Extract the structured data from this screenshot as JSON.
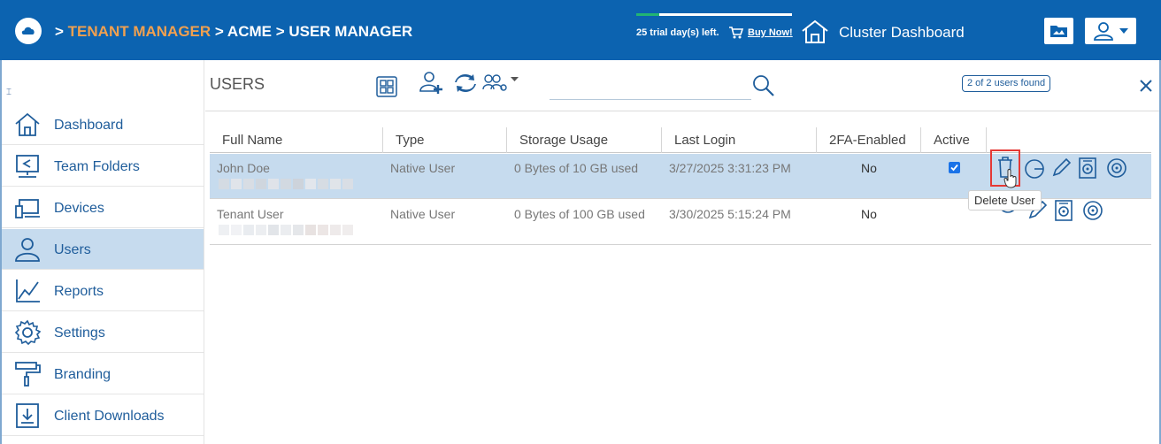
{
  "header": {
    "breadcrumb_prefix": ">",
    "breadcrumb_tenant": "TENANT MANAGER",
    "breadcrumb_rest": " > ACME > USER MANAGER",
    "trial_text": "25 trial day(s) left.",
    "trial_progress_fraction": 0.15,
    "buy_now": "Buy Now!",
    "cluster_dashboard": "Cluster Dashboard",
    "icons": [
      "cloud-logo-icon",
      "cart-icon",
      "house-icon",
      "folder-icon",
      "user-menu-icon",
      "chevron-down-icon"
    ]
  },
  "sidebar": {
    "collapse_glyph": "⌶",
    "items": [
      {
        "label": "Dashboard",
        "icon": "house-icon"
      },
      {
        "label": "Team Folders",
        "icon": "team-folder-icon"
      },
      {
        "label": "Devices",
        "icon": "devices-icon"
      },
      {
        "label": "Users",
        "icon": "users-icon",
        "active": true
      },
      {
        "label": "Reports",
        "icon": "chart-icon"
      },
      {
        "label": "Settings",
        "icon": "gear-icon"
      },
      {
        "label": "Branding",
        "icon": "paint-roller-icon"
      },
      {
        "label": "Client Downloads",
        "icon": "download-icon"
      }
    ]
  },
  "main": {
    "title": "USERS",
    "search": {
      "value": "",
      "placeholder": ""
    },
    "found_badge": "2 of 2 users found",
    "toolbar_icons": [
      "grid-view-icon",
      "add-user-icon",
      "sync-icon",
      "user-group-icon",
      "close-icon"
    ]
  },
  "table": {
    "columns": [
      "Full Name",
      "Type",
      "Storage Usage",
      "Last Login",
      "2FA-Enabled",
      "Active"
    ],
    "rows": [
      {
        "full_name": "John Doe",
        "type": "Native User",
        "storage": "0 Bytes of 10 GB used",
        "last_login": "3/27/2025 3:31:23 PM",
        "twofa": "No",
        "active": true
      },
      {
        "full_name": "Tenant User",
        "type": "Native User",
        "storage": "0 Bytes of 100 GB used",
        "last_login": "3/30/2025 5:15:24 PM",
        "twofa": "No",
        "active": null
      }
    ],
    "row_actions": [
      "delete-user-icon",
      "quota-icon",
      "edit-icon",
      "storage-icon",
      "target-icon"
    ],
    "tooltip": "Delete User"
  },
  "colors": {
    "header_bg": "#0c63b0",
    "tenant_accent": "#f0a050",
    "trial_fill": "#22b573",
    "nav_text": "#1f5d9b",
    "selected_bg": "#c6dbee",
    "highlight": "#e53935"
  }
}
